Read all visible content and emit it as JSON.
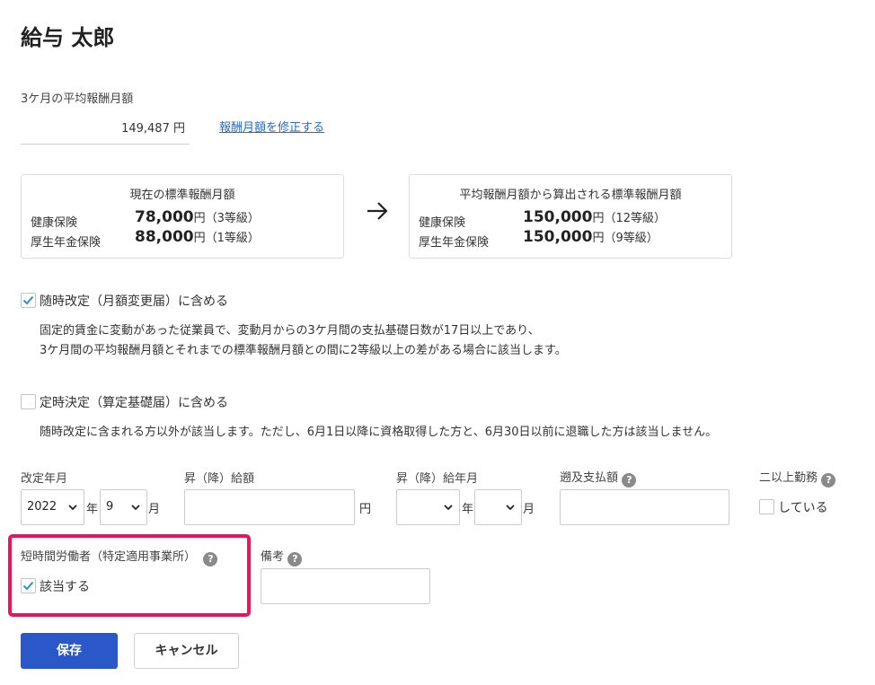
{
  "employee_name": "給与 太郎",
  "average": {
    "label": "3ケ月の平均報酬月額",
    "value": "149,487",
    "unit": "円",
    "edit_link": "報酬月額を修正する"
  },
  "current_card": {
    "title": "現在の標準報酬月額",
    "health_label": "健康保険",
    "health_value": "78,000",
    "health_unit": "円",
    "health_grade": "（3等級）",
    "pension_label": "厚生年金保険",
    "pension_value": "88,000",
    "pension_unit": "円",
    "pension_grade": "（1等級）"
  },
  "calc_card": {
    "title": "平均報酬月額から算出される標準報酬月額",
    "health_label": "健康保険",
    "health_value": "150,000",
    "health_unit": "円",
    "health_grade": "（12等級）",
    "pension_label": "厚生年金保険",
    "pension_value": "150,000",
    "pension_unit": "円",
    "pension_grade": "（9等級）"
  },
  "occasional": {
    "label": "随時改定（月額変更届）に含める",
    "checked": true,
    "desc_line1": "固定的賃金に変動があった従業員で、変動月からの3ケ月間の支払基礎日数が17日以上であり、",
    "desc_line2": "3ケ月間の平均報酬月額とそれまでの標準報酬月額との間に2等級以上の差がある場合に該当します。"
  },
  "regular": {
    "label": "定時決定（算定基礎届）に含める",
    "checked": false,
    "desc": "随時改定に含まれる方以外が該当します。ただし、6月1日以降に資格取得した方と、6月30日以前に退職した方は該当しません。"
  },
  "form": {
    "revision_label": "改定年月",
    "revision_year": "2022",
    "year_suffix": "年",
    "revision_month": "9",
    "month_suffix": "月",
    "raise_amount_label": "昇（降）給額",
    "raise_amount_value": "",
    "yen_suffix": "円",
    "raise_month_label": "昇（降）給年月",
    "raise_year": "",
    "raise_month": "",
    "retro_label": "遡及支払額",
    "retro_value": "",
    "multi_work_label": "二以上勤務",
    "multi_work_option": "している",
    "multi_work_checked": false,
    "short_time_label": "短時間労働者（特定適用事業所）",
    "short_time_option": "該当する",
    "short_time_checked": true,
    "remarks_label": "備考",
    "remarks_value": ""
  },
  "help_glyph": "?",
  "buttons": {
    "save": "保存",
    "cancel": "キャンセル"
  },
  "colors": {
    "primary": "#2a58c9",
    "highlight": "#e8175d",
    "link": "#2b6cc4",
    "check": "#2a8fd6"
  }
}
